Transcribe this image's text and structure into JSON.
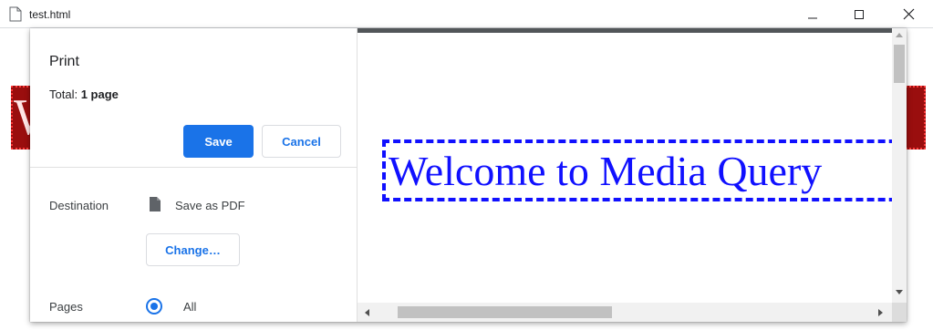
{
  "window": {
    "title": "test.html",
    "controls": [
      "minimize-icon",
      "maximize-icon",
      "close-icon"
    ]
  },
  "print_dialog": {
    "title": "Print",
    "total_label": "Total:",
    "total_value": "1 page",
    "save_label": "Save",
    "cancel_label": "Cancel",
    "destination": {
      "label": "Destination",
      "icon": "pdf-file-icon",
      "value": "Save as PDF",
      "change_label": "Change…"
    },
    "pages": {
      "label": "Pages",
      "selected_value": "All"
    }
  },
  "preview": {
    "heading": "Welcome to Media Query"
  },
  "background_page": {
    "heading_partial": "W"
  },
  "colors": {
    "accent": "#1a73e8",
    "preview_text": "#1010ff",
    "background_banner": "#9a0e0e"
  }
}
